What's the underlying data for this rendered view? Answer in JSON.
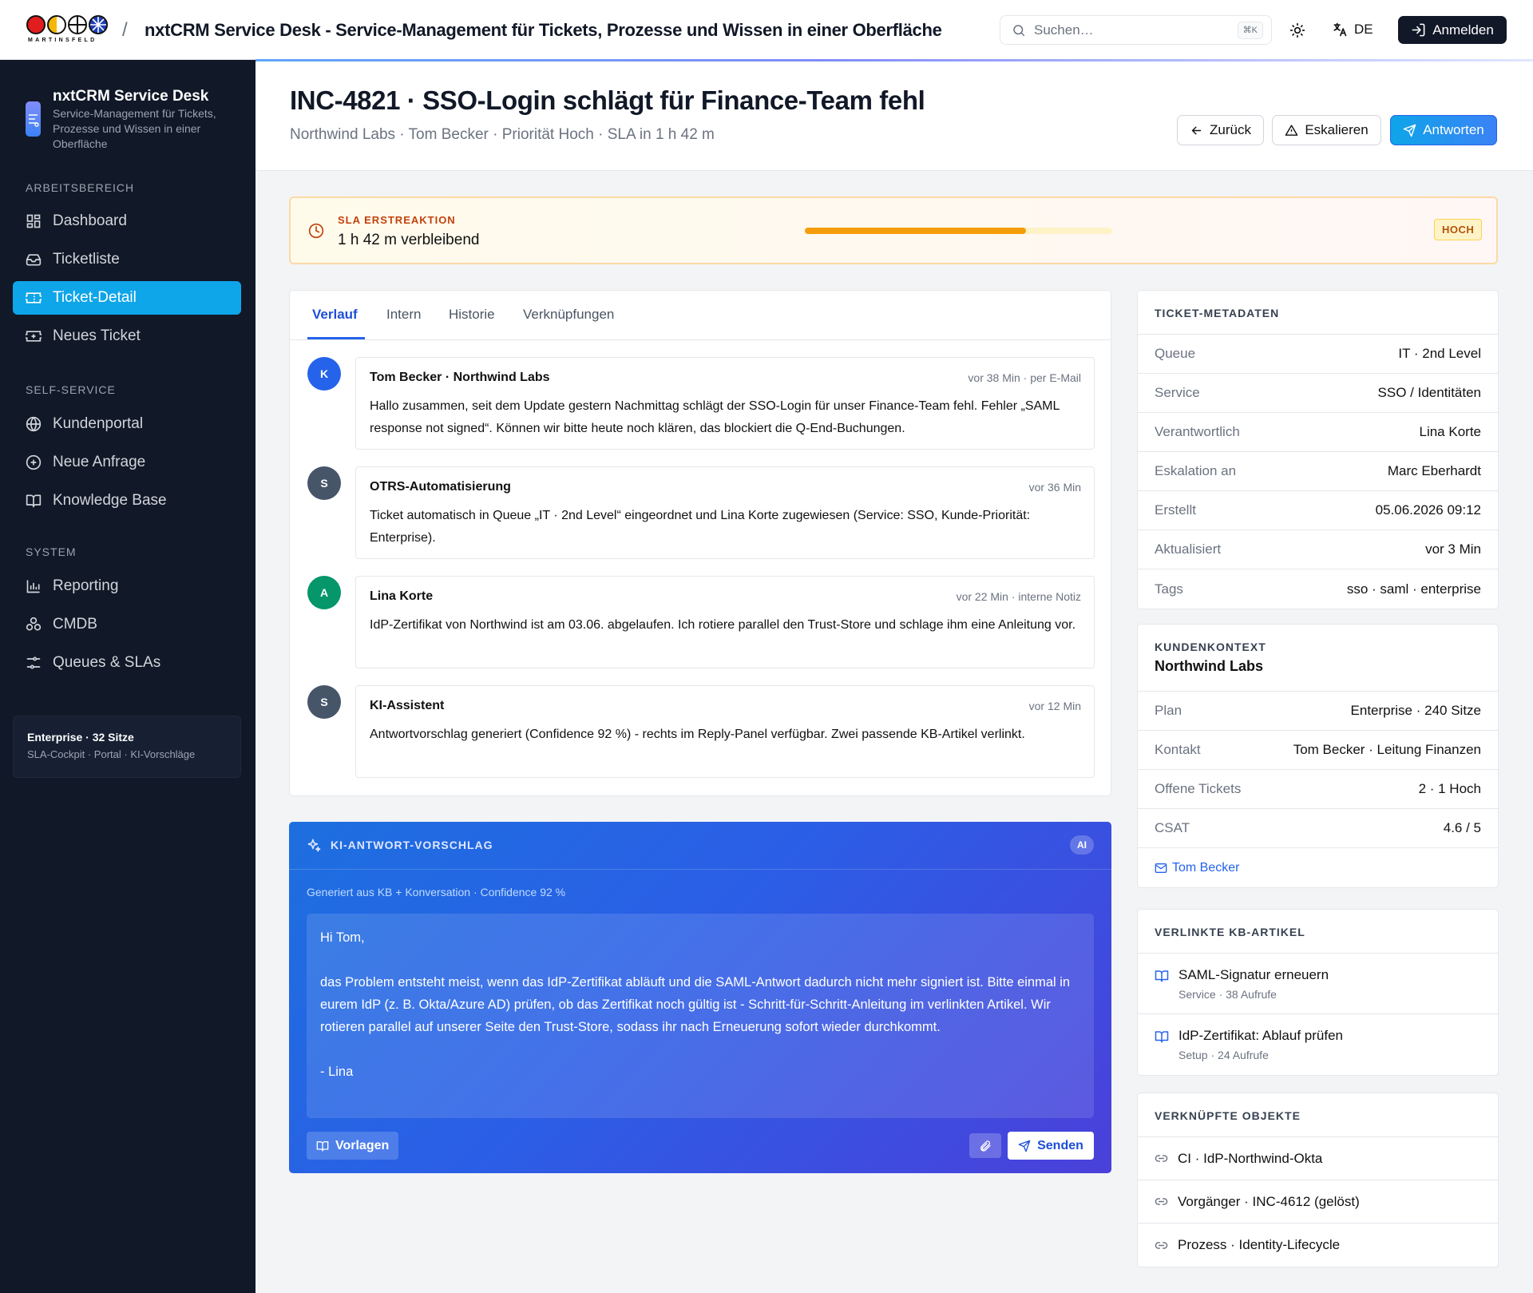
{
  "topbar": {
    "logo_text": "MARTINSFELD",
    "separator": "/",
    "app_title": "nxtCRM Service Desk - Service-Management für Tickets, Prozesse und Wissen in einer Oberfläche",
    "search_placeholder": "Suchen…",
    "search_shortcut": "⌘K",
    "language": "DE",
    "login_label": "Anmelden"
  },
  "sidebar": {
    "brand_name": "nxtCRM Service Desk",
    "brand_subtitle": "Service-Management für Tickets, Prozesse und Wissen in einer Oberfläche",
    "sections": [
      {
        "title": "ARBEITSBEREICH",
        "items": [
          {
            "label": "Dashboard",
            "icon": "dashboard-icon"
          },
          {
            "label": "Ticketliste",
            "icon": "inbox-icon"
          },
          {
            "label": "Ticket-Detail",
            "icon": "ticket-icon",
            "active": true
          },
          {
            "label": "Neues Ticket",
            "icon": "ticket-plus-icon"
          }
        ]
      },
      {
        "title": "SELF-SERVICE",
        "items": [
          {
            "label": "Kundenportal",
            "icon": "globe-icon"
          },
          {
            "label": "Neue Anfrage",
            "icon": "plus-circle-icon"
          },
          {
            "label": "Knowledge Base",
            "icon": "book-icon"
          }
        ]
      },
      {
        "title": "SYSTEM",
        "items": [
          {
            "label": "Reporting",
            "icon": "bar-chart-icon"
          },
          {
            "label": "CMDB",
            "icon": "cmdb-icon"
          },
          {
            "label": "Queues & SLAs",
            "icon": "sliders-icon"
          }
        ]
      }
    ],
    "plan_title": "Enterprise · 32 Sitze",
    "plan_subtitle": "SLA-Cockpit · Portal · KI-Vorschläge"
  },
  "ticket": {
    "title": "INC-4821 · SSO-Login schlägt für Finance-Team fehl",
    "subtitle": "Northwind Labs · Tom Becker · Priorität Hoch · SLA in 1 h 42 m",
    "buttons": {
      "back": "Zurück",
      "escalate": "Eskalieren",
      "reply": "Antworten"
    }
  },
  "sla": {
    "label": "SLA ERSTREAKTION",
    "remaining": "1 h 42 m verbleibend",
    "progress": 0.72,
    "badge": "HOCH"
  },
  "timeline": {
    "tabs": [
      "Verlauf",
      "Intern",
      "Historie",
      "Verknüpfungen"
    ],
    "active_tab": 0,
    "messages": [
      {
        "avatar": "K",
        "avatar_color": "#2563eb",
        "author": "Tom Becker · Northwind Labs",
        "meta": "vor 38 Min · per E-Mail",
        "text": "Hallo zusammen, seit dem Update gestern Nachmittag schlägt der SSO-Login für unser Finance-Team fehl. Fehler „SAML response not signed“. Können wir bitte heute noch klären, das blockiert die Q-End-Buchungen."
      },
      {
        "avatar": "S",
        "avatar_color": "#475569",
        "author": "OTRS-Automatisierung",
        "meta": "vor 36 Min",
        "text": "Ticket automatisch in Queue „IT · 2nd Level“ eingeordnet und Lina Korte zugewiesen (Service: SSO, Kunde-Priorität: Enterprise)."
      },
      {
        "avatar": "A",
        "avatar_color": "#059669",
        "author": "Lina Korte",
        "meta": "vor 22 Min · interne Notiz",
        "text": "IdP-Zertifikat von Northwind ist am 03.06. abgelaufen. Ich rotiere parallel den Trust-Store und schlage ihm eine Anleitung vor."
      },
      {
        "avatar": "S",
        "avatar_color": "#475569",
        "author": "KI-Assistent",
        "meta": "vor 12 Min",
        "text": "Antwortvorschlag generiert (Confidence 92 %) - rechts im Reply-Panel verfügbar. Zwei passende KB-Artikel verlinkt."
      }
    ]
  },
  "ai_suggestion": {
    "title": "KI-ANTWORT-VORSCHLAG",
    "badge": "AI",
    "meta": "Generiert aus KB + Konversation · Confidence 92 %",
    "greeting": "Hi Tom,",
    "body": "das Problem entsteht meist, wenn das IdP-Zertifikat abläuft und die SAML-Antwort dadurch nicht mehr signiert ist. Bitte einmal in eurem IdP (z. B. Okta/Azure AD) prüfen, ob das Zertifikat noch gültig ist - Schritt-für-Schritt-Anleitung im verlinkten Artikel. Wir rotieren parallel auf unserer Seite den Trust-Store, sodass ihr nach Erneuerung sofort wieder durchkommt.",
    "signature": "- Lina",
    "templates_label": "Vorlagen",
    "send_label": "Senden"
  },
  "metadata": {
    "title": "TICKET-METADATEN",
    "rows": [
      {
        "key": "Queue",
        "value": "IT · 2nd Level"
      },
      {
        "key": "Service",
        "value": "SSO / Identitäten"
      },
      {
        "key": "Verantwortlich",
        "value": "Lina Korte"
      },
      {
        "key": "Eskalation an",
        "value": "Marc Eberhardt"
      },
      {
        "key": "Erstellt",
        "value": "05.06.2026 09:12"
      },
      {
        "key": "Aktualisiert",
        "value": "vor 3 Min"
      },
      {
        "key": "Tags",
        "value": "sso · saml · enterprise"
      }
    ]
  },
  "customer": {
    "label": "KUNDENKONTEXT",
    "name": "Northwind Labs",
    "rows": [
      {
        "key": "Plan",
        "value": "Enterprise · 240 Sitze"
      },
      {
        "key": "Kontakt",
        "value": "Tom Becker · Leitung Finanzen"
      },
      {
        "key": "Offene Tickets",
        "value": "2 · 1 Hoch"
      },
      {
        "key": "CSAT",
        "value": "4.6 / 5"
      }
    ],
    "contact_link": "Tom Becker"
  },
  "kb_articles": {
    "title": "VERLINKTE KB-ARTIKEL",
    "items": [
      {
        "title": "SAML-Signatur erneuern",
        "meta": "Service · 38 Aufrufe"
      },
      {
        "title": "IdP-Zertifikat: Ablauf prüfen",
        "meta": "Setup · 24 Aufrufe"
      }
    ]
  },
  "linked_objects": {
    "title": "VERKNÜPFTE OBJEKTE",
    "items": [
      "CI · IdP-Northwind-Okta",
      "Vorgänger · INC-4612 (gelöst)",
      "Prozess · Identity-Lifecycle"
    ]
  },
  "colors": {
    "accent": "#0ea5e9",
    "sidebar_bg": "#111827",
    "sla_bar": "#f59e0b",
    "ai_panel": "#2b5ee6"
  }
}
